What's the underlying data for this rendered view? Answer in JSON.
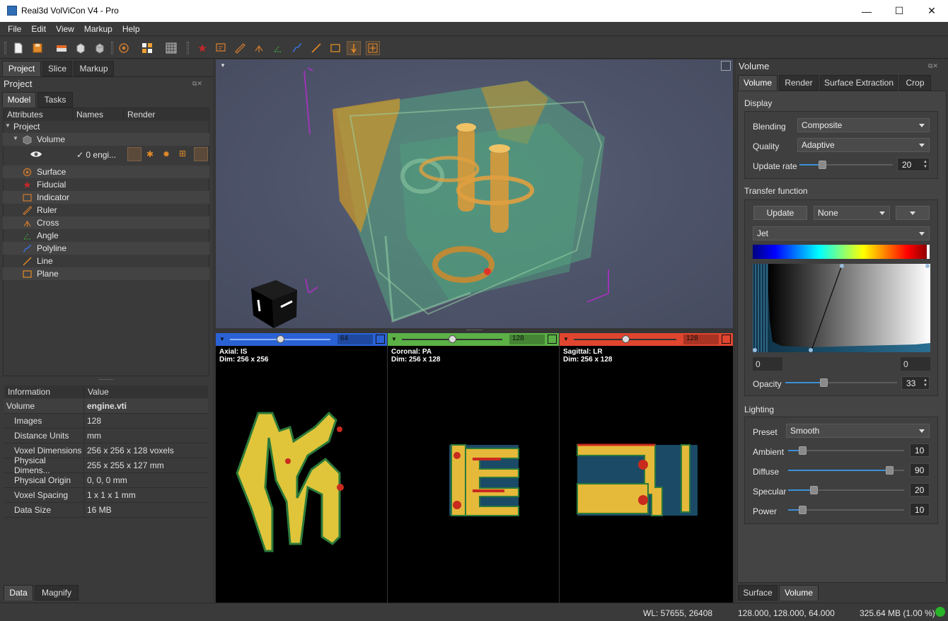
{
  "window": {
    "title": "Real3d VolViCon V4 - Pro",
    "minimize": "—",
    "maximize": "☐",
    "close": "✕"
  },
  "menu": [
    "File",
    "Edit",
    "View",
    "Markup",
    "Help"
  ],
  "left_tabs": [
    "Project",
    "Slice",
    "Markup"
  ],
  "project_panel": {
    "title": "Project",
    "subtabs": [
      "Model",
      "Tasks"
    ],
    "columns": [
      "Attributes",
      "Names",
      "Render"
    ],
    "root": "Project",
    "volume_node": "Volume",
    "volume_item": "✓  0 engi...",
    "markups": [
      {
        "label": "Surface",
        "icon": "surface-icon"
      },
      {
        "label": "Fiducial",
        "icon": "fiducial-icon"
      },
      {
        "label": "Indicator",
        "icon": "indicator-icon"
      },
      {
        "label": "Ruler",
        "icon": "ruler-icon"
      },
      {
        "label": "Cross",
        "icon": "cross-icon"
      },
      {
        "label": "Angle",
        "icon": "angle-icon"
      },
      {
        "label": "Polyline",
        "icon": "polyline-icon"
      },
      {
        "label": "Line",
        "icon": "line-icon"
      },
      {
        "label": "Plane",
        "icon": "plane-icon"
      }
    ]
  },
  "info_panel": {
    "columns": [
      "Information",
      "Value"
    ],
    "title_key": "Volume",
    "title_value": "engine.vti",
    "rows": [
      {
        "k": "Images",
        "v": "128"
      },
      {
        "k": "Distance Units",
        "v": "mm"
      },
      {
        "k": "Voxel Dimensions",
        "v": "256 x 256 x 128 voxels"
      },
      {
        "k": "Physical Dimens...",
        "v": "255 x 255 x 127 mm"
      },
      {
        "k": "Physical Origin",
        "v": "0, 0, 0 mm"
      },
      {
        "k": "Voxel Spacing",
        "v": "1 x 1 x 1 mm"
      },
      {
        "k": "Data Size",
        "v": "16 MB"
      }
    ]
  },
  "bottom_left_tabs": [
    "Data",
    "Magnify"
  ],
  "slices": [
    {
      "name": "Axial: IS",
      "dim": "Dim: 256 x 256",
      "value": "64",
      "color": "#2a62d6",
      "level": 0.5
    },
    {
      "name": "Coronal: PA",
      "dim": "Dim: 256 x 128",
      "value": "128",
      "color": "#5bb046",
      "level": 0.5
    },
    {
      "name": "Sagittal: LR",
      "dim": "Dim: 256 x 128",
      "value": "128",
      "color": "#e0452f",
      "level": 0.5
    }
  ],
  "right_panel": {
    "title": "Volume",
    "tabs": [
      "Volume",
      "Render",
      "Surface Extraction",
      "Crop"
    ],
    "display": {
      "title": "Display",
      "blending_label": "Blending",
      "blending": "Composite",
      "quality_label": "Quality",
      "quality": "Adaptive",
      "update_rate_label": "Update rate",
      "update_rate": "20",
      "update_rate_level": 0.22
    },
    "transfer": {
      "title": "Transfer function",
      "update_button": "Update",
      "preset": "None",
      "colormap": "Jet",
      "min": "0",
      "max": "0",
      "opacity_label": "Opacity",
      "opacity": "33",
      "opacity_level": 0.33
    },
    "lighting": {
      "title": "Lighting",
      "preset_label": "Preset",
      "preset": "Smooth",
      "params": [
        {
          "label": "Ambient",
          "value": "10",
          "level": 0.1
        },
        {
          "label": "Diffuse",
          "value": "90",
          "level": 0.9
        },
        {
          "label": "Specular",
          "value": "20",
          "level": 0.2
        },
        {
          "label": "Power",
          "value": "10",
          "level": 0.1
        }
      ]
    },
    "bottom_tabs": [
      "Surface",
      "Volume"
    ]
  },
  "status": {
    "wl": "WL: 57655, 26408",
    "coords": "128.000, 128.000, 64.000",
    "memory": "325.64 MB (1.00 %)"
  },
  "colors": {
    "accent": "#3d8fd6",
    "axial": "#2a62d6",
    "coronal": "#5bb046",
    "sagittal": "#e0452f"
  }
}
